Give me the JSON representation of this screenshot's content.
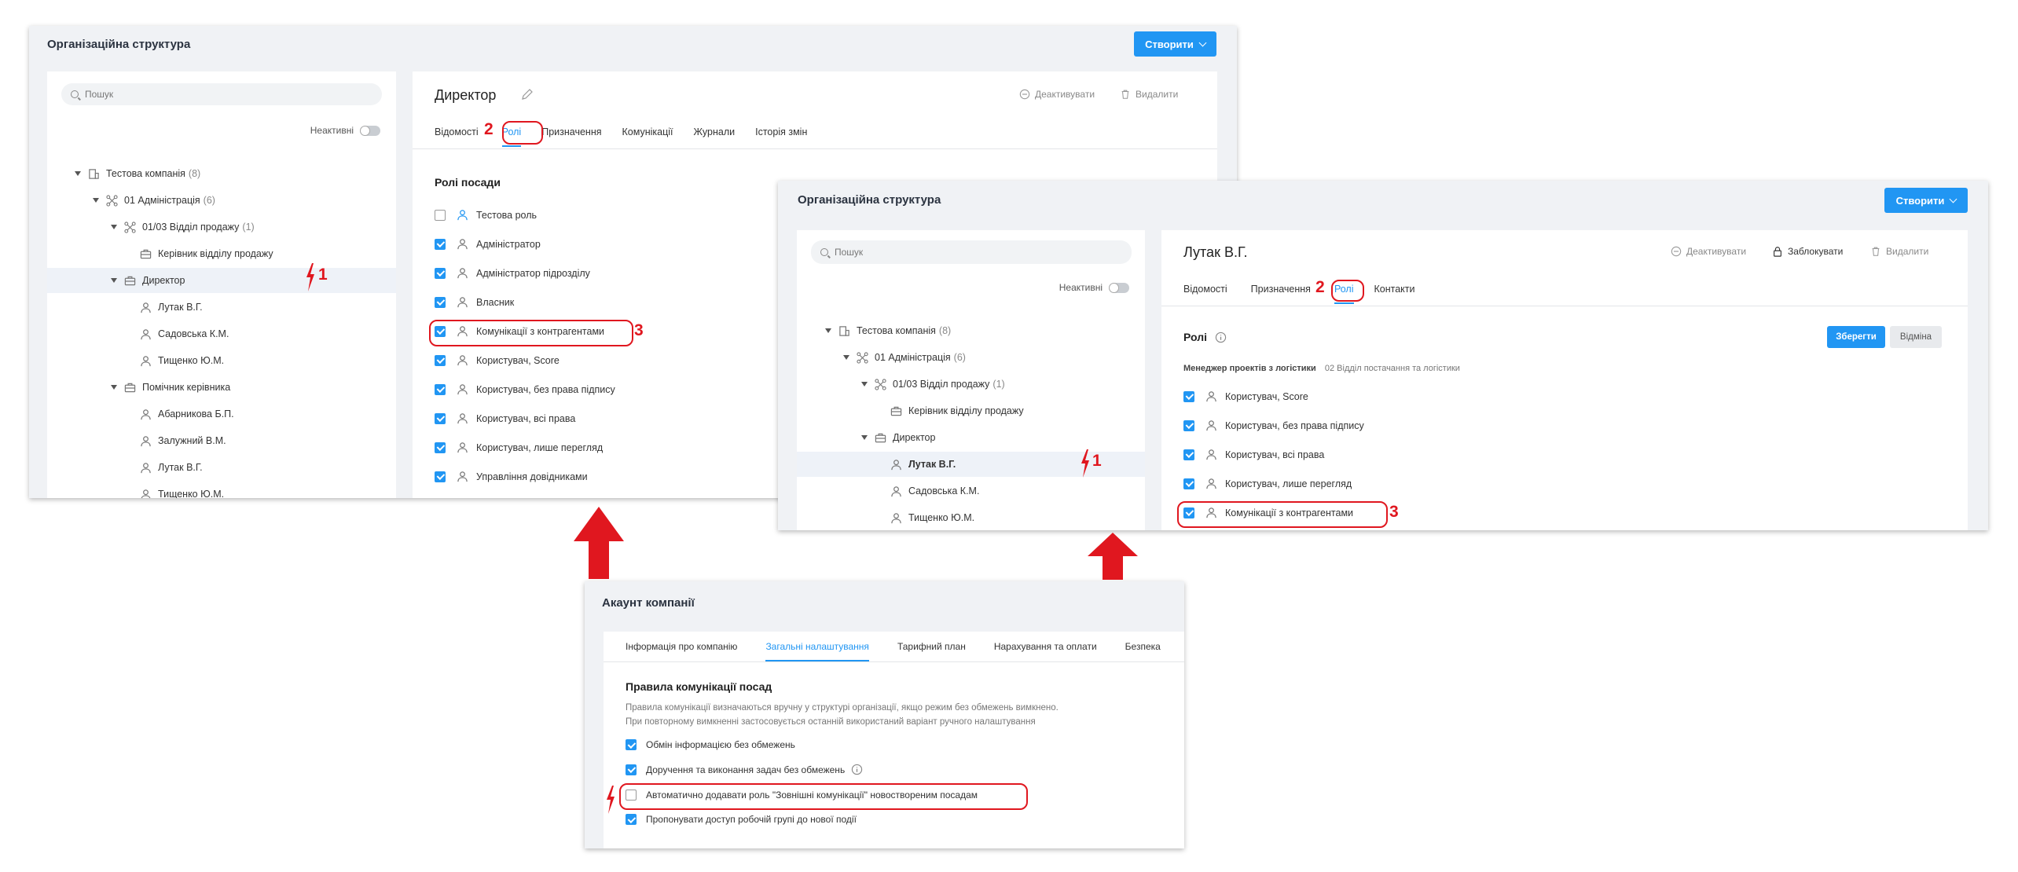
{
  "panel_main": {
    "title": "Організаційна структура",
    "create_label": "Створити",
    "search_placeholder": "Пошук",
    "inactive_label": "Неактивні",
    "tree": [
      {
        "label": "Тестова компанія",
        "count": "(8)"
      },
      {
        "label": "01 Адміністрація",
        "count": "(6)"
      },
      {
        "label": "01/03 Відділ продажу",
        "count": "(1)"
      },
      {
        "label": "Керівник відділу продажу",
        "count": ""
      },
      {
        "label": "Директор",
        "count": ""
      },
      {
        "label": "Лутак В.Г.",
        "count": ""
      },
      {
        "label": "Садовська К.М.",
        "count": ""
      },
      {
        "label": "Тищенко Ю.М.",
        "count": ""
      },
      {
        "label": "Помічник керівника",
        "count": ""
      },
      {
        "label": "Абарникова Б.П.",
        "count": ""
      },
      {
        "label": "Залужний В.М.",
        "count": ""
      },
      {
        "label": "Лутак В.Г.",
        "count": ""
      },
      {
        "label": "Тищенко Ю.М.",
        "count": ""
      }
    ],
    "detail_title": "Директор",
    "deactivate_label": "Деактивувати",
    "delete_label": "Видалити",
    "tabs": [
      "Відомості",
      "Ролі",
      "Призначення",
      "Комунікації",
      "Журнали",
      "Історія змін"
    ],
    "roles_heading": "Ролі посади",
    "roles": [
      {
        "label": "Тестова роль",
        "checked": false
      },
      {
        "label": "Адміністратор",
        "checked": true
      },
      {
        "label": "Адміністратор підрозділу",
        "checked": true
      },
      {
        "label": "Власник",
        "checked": true
      },
      {
        "label": "Комунікації з контрагентами",
        "checked": true
      },
      {
        "label": "Користувач, Score",
        "checked": true
      },
      {
        "label": "Користувач, без права підпису",
        "checked": true
      },
      {
        "label": "Користувач, всі права",
        "checked": true
      },
      {
        "label": "Користувач, лише перегляд",
        "checked": true
      },
      {
        "label": "Управління довідниками",
        "checked": true
      }
    ]
  },
  "panel_person": {
    "title": "Організаційна структура",
    "create_label": "Створити",
    "search_placeholder": "Пошук",
    "inactive_label": "Неактивні",
    "tree": [
      {
        "label": "Тестова компанія",
        "count": "(8)"
      },
      {
        "label": "01 Адміністрація",
        "count": "(6)"
      },
      {
        "label": "01/03 Відділ продажу",
        "count": "(1)"
      },
      {
        "label": "Керівник відділу продажу",
        "count": ""
      },
      {
        "label": "Директор",
        "count": ""
      },
      {
        "label": "Лутак В.Г.",
        "count": ""
      },
      {
        "label": "Садовська К.М.",
        "count": ""
      },
      {
        "label": "Тищенко Ю.М.",
        "count": ""
      }
    ],
    "detail_title": "Лутак В.Г.",
    "deactivate_label": "Деактивувати",
    "block_label": "Заблокувати",
    "delete_label": "Видалити",
    "tabs": [
      "Відомості",
      "Призначення",
      "Ролі",
      "Контакти"
    ],
    "roles_heading": "Ролі",
    "save_label": "Зберегти",
    "cancel_label": "Відміна",
    "position_label": "Менеджер проектів з логістики",
    "position_dept": "02 Відділ постачання та логістики",
    "roles": [
      {
        "label": "Користувач, Score",
        "checked": true
      },
      {
        "label": "Користувач, без права підпису",
        "checked": true
      },
      {
        "label": "Користувач, всі права",
        "checked": true
      },
      {
        "label": "Користувач, лише перегляд",
        "checked": true
      },
      {
        "label": "Комунікації з контрагентами",
        "checked": true
      }
    ]
  },
  "panel_account": {
    "title": "Акаунт компанії",
    "tabs": [
      "Інформація про компанію",
      "Загальні налаштування",
      "Тарифний план",
      "Нарахування та оплати",
      "Безпека"
    ],
    "heading": "Правила комунікації посад",
    "desc_line1": "Правила комунікації визначаються вручну у структурі організації, якщо режим без обмежень вимкнено.",
    "desc_line2": "При повторному вимкненні застосовується останній використаний варіант ручного налаштування",
    "options": [
      {
        "label": "Обмін інформацією без обмежень",
        "checked": true
      },
      {
        "label": "Доручення та виконання задач без обмежень",
        "checked": true
      },
      {
        "label": "Автоматично додавати роль \"Зовнішні комунікації\" новоствореним посадам",
        "checked": false
      },
      {
        "label": "Пропонувати доступ робочій групі до нової події",
        "checked": true
      }
    ]
  },
  "annotations": {
    "n1": "1",
    "n2": "2",
    "n3": "3"
  },
  "colors": {
    "accent": "#2196f3",
    "annotation": "#e0171f",
    "panel_bg": "#f0f2f5"
  }
}
